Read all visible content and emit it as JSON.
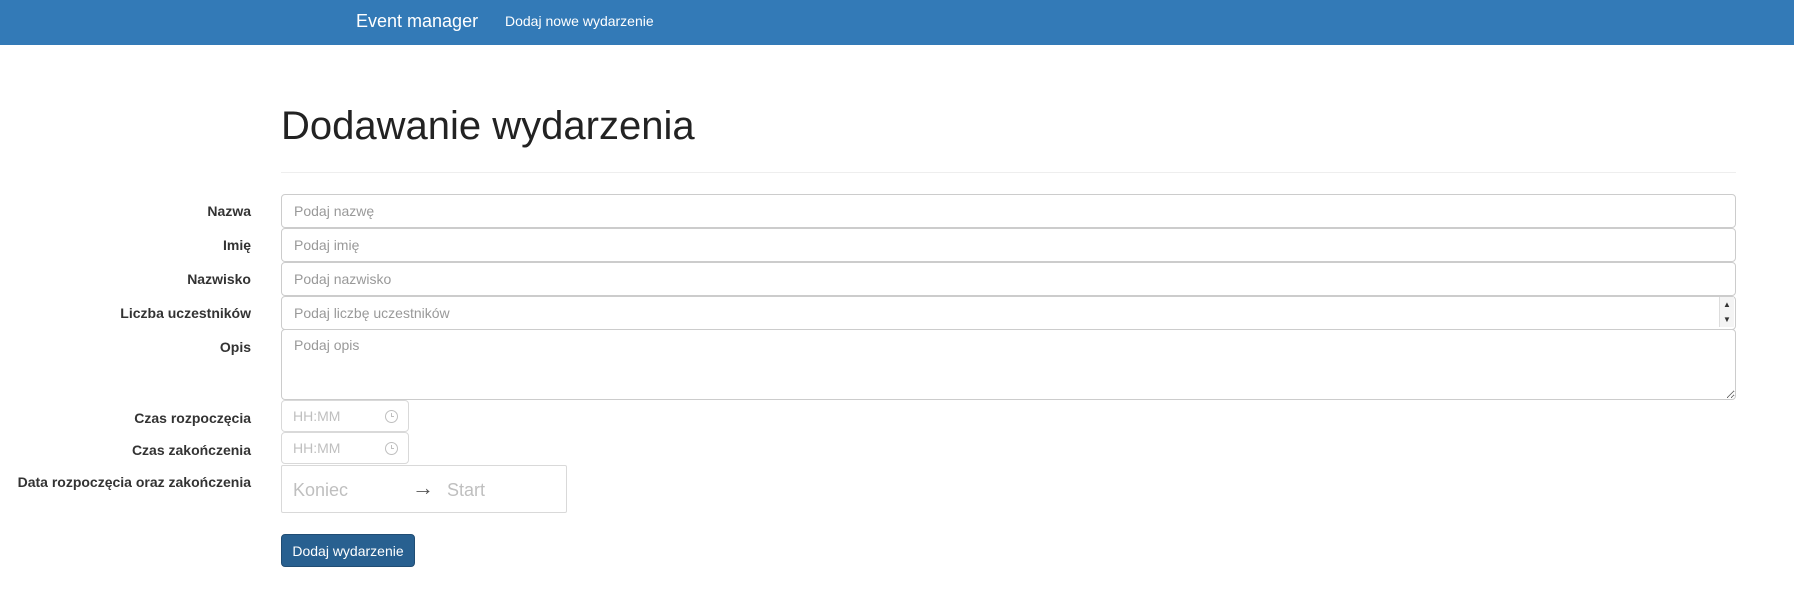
{
  "navbar": {
    "brand": "Event manager",
    "links": [
      {
        "label": "Dodaj nowe wydarzenie"
      }
    ],
    "color": "#337ab7"
  },
  "page": {
    "title": "Dodawanie wydarzenia"
  },
  "form": {
    "name": {
      "label": "Nazwa",
      "placeholder": "Podaj nazwę",
      "value": ""
    },
    "first_name": {
      "label": "Imię",
      "placeholder": "Podaj imię",
      "value": ""
    },
    "last_name": {
      "label": "Nazwisko",
      "placeholder": "Podaj nazwisko",
      "value": ""
    },
    "participants": {
      "label": "Liczba uczestników",
      "placeholder": "Podaj liczbę uczestników",
      "value": ""
    },
    "description": {
      "label": "Opis",
      "placeholder": "Podaj opis",
      "value": ""
    },
    "start_time": {
      "label": "Czas rozpoczęcia",
      "placeholder": "HH:MM"
    },
    "end_time": {
      "label": "Czas zakończenia",
      "placeholder": "HH:MM"
    },
    "date_range": {
      "label": "Data rozpoczęcia oraz zakończenia",
      "start_placeholder": "Koniec",
      "arrow": "→",
      "end_placeholder": "Start"
    },
    "submit_label": "Dodaj wydarzenie",
    "submit_color": "#286090"
  }
}
